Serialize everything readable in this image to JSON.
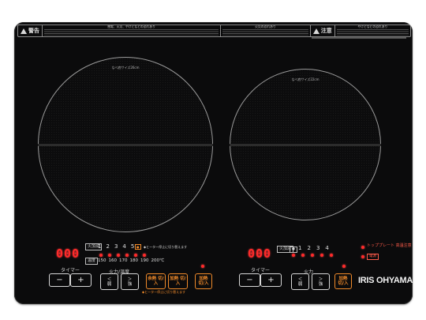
{
  "warning": {
    "badge_left": "警告",
    "badge_right": "注意",
    "col1_title": "感電、火災、やけどなどの恐れあり",
    "col2_title": "火災の恐れあり",
    "col3_title": "やけどなどの恐れあり"
  },
  "zones": {
    "left_size": "なべ底サイズ26cm",
    "right_size": "なべ底サイズ22cm"
  },
  "left_panel": {
    "display": "000",
    "timer_label": "タイマー",
    "level_tag": "火加減",
    "temp_tag": "温度",
    "levels": [
      "1",
      "2",
      "3",
      "4",
      "5"
    ],
    "temps": [
      "150",
      "160",
      "170",
      "180",
      "190",
      "200℃"
    ],
    "heat_label": "火力/温度",
    "minus": "−",
    "plus": "+",
    "weak": "弱",
    "strong": "強",
    "key_delay": "余熱 切/入",
    "key_heat": "加熱 切/入",
    "orange_note_top": "◆ヒーター停止に切り替えます",
    "orange_note_bottom": "◆ヒーター停止に切り替えます"
  },
  "right_panel": {
    "display": "000",
    "timer_label": "タイマー",
    "level_tag": "火加減",
    "levels": [
      "1",
      "2",
      "3",
      "4"
    ],
    "heat_label": "火力",
    "minus": "−",
    "plus": "+",
    "weak": "弱",
    "strong": "強",
    "key_heat": "加熱 切/入",
    "top_plate_label": "トッププレート 高温注意",
    "power_tag": "電源"
  },
  "brand": {
    "name": "IRIS OHYAMA"
  },
  "colors": {
    "glass": "#0b0b0c",
    "led_red": "#ff2a2a",
    "orange": "#f08a2a"
  }
}
